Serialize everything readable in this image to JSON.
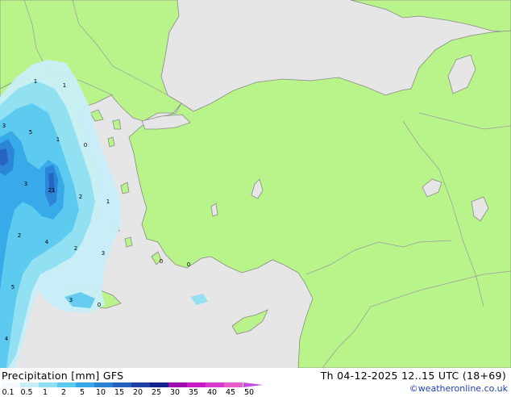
{
  "title": "Precipitation [mm]  GFS",
  "timestamp": "Th 04-12-2025 12..15 UTC (18+69)",
  "credit": "©weatheronline.co.uk",
  "legend": {
    "ticks": [
      "0.1",
      "0.5",
      "1",
      "2",
      "5",
      "10",
      "15",
      "20",
      "25",
      "30",
      "35",
      "40",
      "45",
      "50"
    ],
    "colors": [
      "#f5fbfd",
      "#c8eef8",
      "#8edff2",
      "#5bc8ee",
      "#36a7e8",
      "#2a84d6",
      "#2761c0",
      "#1f3fa8",
      "#15238c",
      "#a10eb0",
      "#c71ac8",
      "#d83ad0",
      "#e65cc8",
      "#c84be0"
    ]
  },
  "map_labels": [
    "1",
    "1",
    "3",
    "5",
    "1",
    "0",
    "3",
    "21",
    "2",
    "1",
    "2",
    "4",
    "2",
    "3",
    "0",
    "0",
    "5",
    "3",
    "0",
    "4"
  ],
  "colors": {
    "land": "#b9f48a",
    "sea": "#e6e6e6",
    "border": "#9a9a9a",
    "coast": "#8a8a8a"
  }
}
